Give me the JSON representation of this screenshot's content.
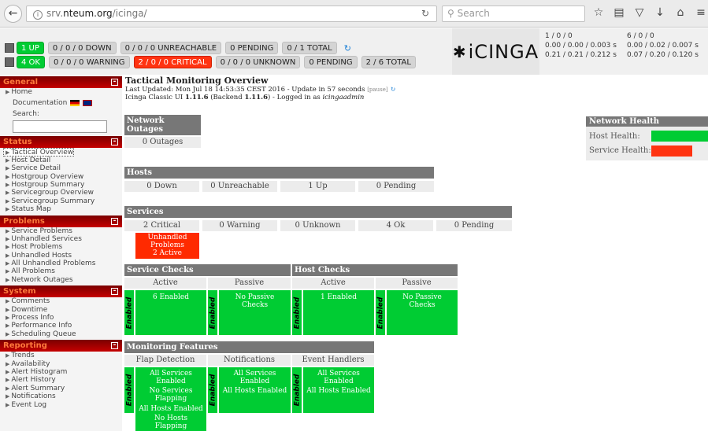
{
  "browser": {
    "url_domain": "srv.",
    "url_domain_bold": "nteum.org",
    "url_path": "/icinga/",
    "search_placeholder": "Search"
  },
  "header": {
    "row1": [
      "1 UP",
      "0 / 0 / 0 DOWN",
      "0 / 0 / 0 UNREACHABLE",
      "0 PENDING",
      "0 / 1 TOTAL"
    ],
    "row2": [
      "4 OK",
      "0 / 0 / 0 WARNING",
      "2 / 0 / 0 CRITICAL",
      "0 / 0 / 0 UNKNOWN",
      "0 PENDING",
      "2 / 6 TOTAL"
    ],
    "logo_text": "iCINGA",
    "perf": {
      "a1": "1 / 0 / 0",
      "a2": "0.00 / 0.00 / 0.003 s",
      "a3": "0.21 / 0.21 / 0.212 s",
      "b1": "6 / 0 / 0",
      "b2": "0.00 / 0.02 / 0.007 s",
      "b3": "0.07 / 0.20 / 0.120 s"
    }
  },
  "sidebar": {
    "general": "General",
    "home": "Home",
    "documentation": "Documentation",
    "search_label": "Search:",
    "status": "Status",
    "status_items": [
      "Tactical Overview",
      "Host Detail",
      "Service Detail",
      "Hostgroup Overview",
      "Hostgroup Summary",
      "Servicegroup Overview",
      "Servicegroup Summary",
      "Status Map"
    ],
    "problems": "Problems",
    "problems_items": [
      "Service Problems",
      "Unhandled Services",
      "Host Problems",
      "Unhandled Hosts",
      "All Unhandled Problems",
      "All Problems",
      "Network Outages"
    ],
    "system": "System",
    "system_items": [
      "Comments",
      "Downtime",
      "Process Info",
      "Performance Info",
      "Scheduling Queue"
    ],
    "reporting": "Reporting",
    "reporting_items": [
      "Trends",
      "Availability",
      "Alert Histogram",
      "Alert History",
      "Alert Summary",
      "Notifications",
      "Event Log"
    ]
  },
  "main": {
    "title": "Tactical Monitoring Overview",
    "updated": "Last Updated: Mon Jul 18 14:53:35 CEST 2016 - Update in 57 seconds",
    "pause": "[pause]",
    "version_prefix": "Icinga Classic UI",
    "ui_version": "1.11.6",
    "backend_prefix": "(Backend",
    "backend_version": "1.11.6",
    "logged_prefix": ") - Logged in as",
    "user": "icingaadmin",
    "network_outages_title": "Network Outages",
    "outages_value": "0 Outages",
    "hosts_title": "Hosts",
    "hosts": [
      "0 Down",
      "0 Unreachable",
      "1 Up",
      "0 Pending"
    ],
    "services_title": "Services",
    "services": [
      "2 Critical",
      "0 Warning",
      "0 Unknown",
      "4 Ok",
      "0 Pending"
    ],
    "unhandled": "Unhandled Problems",
    "unhandled_active": "2 Active",
    "service_checks_title": "Service Checks",
    "host_checks_title": "Host Checks",
    "active": "Active",
    "passive": "Passive",
    "enabled_label": "Enabled",
    "svc_active": "6 Enabled",
    "svc_passive": "No Passive Checks",
    "host_active": "1 Enabled",
    "host_passive": "No Passive Checks",
    "monitoring_features_title": "Monitoring Features",
    "flap_detection": "Flap Detection",
    "notifications": "Notifications",
    "event_handlers": "Event Handlers",
    "flap_lines": [
      "All Services Enabled",
      "No Services Flapping",
      "All Hosts Enabled",
      "No Hosts Flapping"
    ],
    "notif_lines": [
      "All Services Enabled",
      "All Hosts Enabled"
    ],
    "event_lines": [
      "All Services Enabled",
      "All Hosts Enabled"
    ],
    "network_health_title": "Network Health",
    "host_health": "Host Health:",
    "service_health": "Service Health:"
  },
  "colors": {
    "ok": "#00cc33",
    "critical": "#ff2a00",
    "panel_header": "#777777"
  }
}
